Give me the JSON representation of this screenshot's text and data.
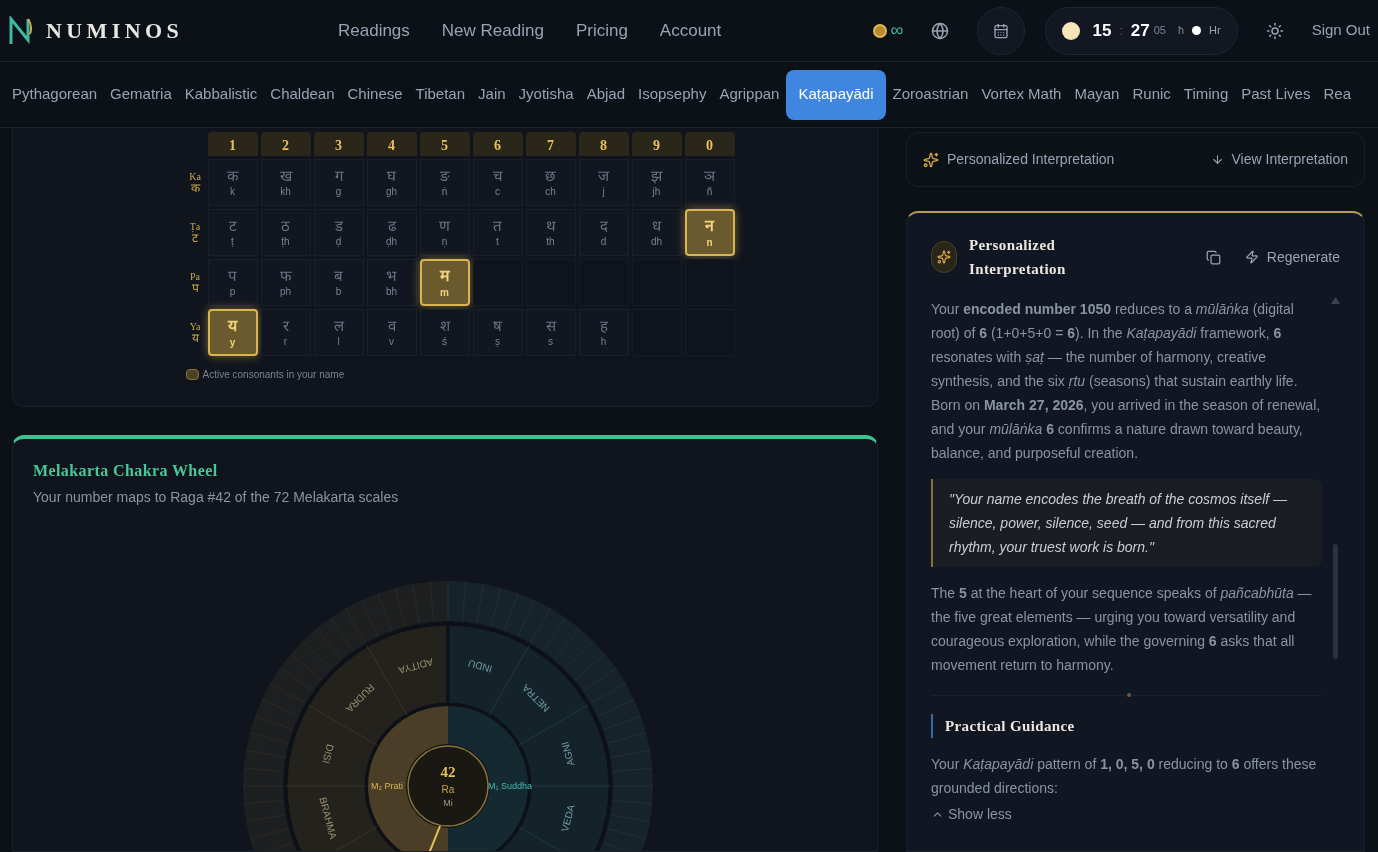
{
  "header": {
    "logo": "NUMINOS",
    "nav": [
      {
        "label": "Readings"
      },
      {
        "label": "New Reading"
      },
      {
        "label": "Pricing"
      },
      {
        "label": "Account"
      }
    ],
    "credits": "∞",
    "clock": {
      "hours": "15",
      "separator": ":",
      "minutes": "27",
      "seconds": "05",
      "unit": "ħ",
      "format": "Hr"
    },
    "sign_out": "Sign Out"
  },
  "tabs": [
    {
      "label": "Pythagorean",
      "selected": false
    },
    {
      "label": "Gematria",
      "selected": false
    },
    {
      "label": "Kabbalistic",
      "selected": false
    },
    {
      "label": "Chaldean",
      "selected": false
    },
    {
      "label": "Chinese",
      "selected": false
    },
    {
      "label": "Tibetan",
      "selected": false
    },
    {
      "label": "Jain",
      "selected": false
    },
    {
      "label": "Jyotisha",
      "selected": false
    },
    {
      "label": "Abjad",
      "selected": false
    },
    {
      "label": "Isopsephy",
      "selected": false
    },
    {
      "label": "Agrippan",
      "selected": false
    },
    {
      "label": "Kaṭapayādi",
      "selected": true
    },
    {
      "label": "Zoroastrian",
      "selected": false
    },
    {
      "label": "Vortex Math",
      "selected": false
    },
    {
      "label": "Mayan",
      "selected": false
    },
    {
      "label": "Runic",
      "selected": false
    },
    {
      "label": "Timing",
      "selected": false
    },
    {
      "label": "Past Lives",
      "selected": false
    },
    {
      "label": "Rea",
      "selected": false
    }
  ],
  "consonant_grid": {
    "columns": [
      "1",
      "2",
      "3",
      "4",
      "5",
      "6",
      "7",
      "8",
      "9",
      "0"
    ],
    "rows": [
      {
        "label": "Ka",
        "glyph": "क",
        "cells": [
          {
            "letter": "क",
            "sound": "k",
            "active": false
          },
          {
            "letter": "ख",
            "sound": "kh",
            "active": false
          },
          {
            "letter": "ग",
            "sound": "g",
            "active": false
          },
          {
            "letter": "घ",
            "sound": "gh",
            "active": false
          },
          {
            "letter": "ङ",
            "sound": "ṅ",
            "active": false
          },
          {
            "letter": "च",
            "sound": "c",
            "active": false
          },
          {
            "letter": "छ",
            "sound": "ch",
            "active": false
          },
          {
            "letter": "ज",
            "sound": "j",
            "active": false
          },
          {
            "letter": "झ",
            "sound": "jh",
            "active": false
          },
          {
            "letter": "ञ",
            "sound": "ñ",
            "active": false
          }
        ]
      },
      {
        "label": "Ṭa",
        "glyph": "ट",
        "cells": [
          {
            "letter": "ट",
            "sound": "ṭ",
            "active": false
          },
          {
            "letter": "ठ",
            "sound": "ṭh",
            "active": false
          },
          {
            "letter": "ड",
            "sound": "ḍ",
            "active": false
          },
          {
            "letter": "ढ",
            "sound": "ḍh",
            "active": false
          },
          {
            "letter": "ण",
            "sound": "ṇ",
            "active": false
          },
          {
            "letter": "त",
            "sound": "t",
            "active": false
          },
          {
            "letter": "थ",
            "sound": "th",
            "active": false
          },
          {
            "letter": "द",
            "sound": "d",
            "active": false
          },
          {
            "letter": "ध",
            "sound": "dh",
            "active": false
          },
          {
            "letter": "न",
            "sound": "n",
            "active": true
          }
        ]
      },
      {
        "label": "Pa",
        "glyph": "प",
        "cells": [
          {
            "letter": "प",
            "sound": "p",
            "active": false
          },
          {
            "letter": "फ",
            "sound": "ph",
            "active": false
          },
          {
            "letter": "ब",
            "sound": "b",
            "active": false
          },
          {
            "letter": "भ",
            "sound": "bh",
            "active": false
          },
          {
            "letter": "म",
            "sound": "m",
            "active": true
          }
        ]
      },
      {
        "label": "Ya",
        "glyph": "य",
        "cells": [
          {
            "letter": "य",
            "sound": "y",
            "active": true
          },
          {
            "letter": "र",
            "sound": "r",
            "active": false
          },
          {
            "letter": "ल",
            "sound": "l",
            "active": false
          },
          {
            "letter": "व",
            "sound": "v",
            "active": false
          },
          {
            "letter": "श",
            "sound": "ś",
            "active": false
          },
          {
            "letter": "ष",
            "sound": "ṣ",
            "active": false
          },
          {
            "letter": "स",
            "sound": "s",
            "active": false
          },
          {
            "letter": "ह",
            "sound": "h",
            "active": false
          }
        ]
      }
    ],
    "legend": "Active consonants in your name"
  },
  "chakra_wheel": {
    "title": "Melakarta Chakra Wheel",
    "subtitle": "Your number maps to Raga #42 of the 72 Melakarta scales",
    "number": "42",
    "raga": "Ra",
    "note": "Mi",
    "left_label": "M₂ Prati",
    "right_label": "M₁ Suddha",
    "chakras": [
      {
        "name": "INDU",
        "kind": "right"
      },
      {
        "name": "NETRA",
        "kind": "right"
      },
      {
        "name": "AGNI",
        "kind": "right"
      },
      {
        "name": "VEDA",
        "kind": "right"
      },
      {
        "name": "ADITYA",
        "kind": "left"
      },
      {
        "name": "RUDRA",
        "kind": "left"
      },
      {
        "name": "DISI",
        "kind": "left"
      },
      {
        "name": "BRAHMA",
        "kind": "left"
      }
    ]
  },
  "interpretation_bar": {
    "label": "Personalized Interpretation",
    "action": "View Interpretation"
  },
  "interpretation": {
    "title": "Personalized Interpretation",
    "regenerate": "Regenerate",
    "blocks": [
      {
        "kind": "paragraph",
        "text": "Your **encoded number 1050** reduces to a *mūlāṅka* (digital root) of **6** (1+0+5+0 = **6**). In the *Kaṭapayādi* framework, **6** resonates with *ṣaṭ* — the number of harmony, creative synthesis, and the six *ṛtu* (seasons) that sustain earthly life. Born on **March 27, 2026**, you arrived in the season of renewal, and your *mūlāṅka* **6** confirms a nature drawn toward beauty, balance, and purposeful creation."
      },
      {
        "kind": "quote",
        "text": "\"Your name encodes the breath of the cosmos itself — silence, power, silence, seed — and from this sacred rhythm, your truest work is born.\""
      },
      {
        "kind": "paragraph",
        "text": "The **5** at the heart of your sequence speaks of *pañcabhūta* — the five great elements — urging you toward versatility and courageous exploration, while the governing **6** asks that all movement return to harmony."
      },
      {
        "kind": "divider"
      },
      {
        "kind": "heading",
        "text": "Practical Guidance"
      },
      {
        "kind": "paragraph",
        "text": "Your *Kaṭapayādi* pattern of **1, 0, 5, 0** reducing to **6** offers these grounded directions:"
      }
    ],
    "toggle": "Show less"
  }
}
